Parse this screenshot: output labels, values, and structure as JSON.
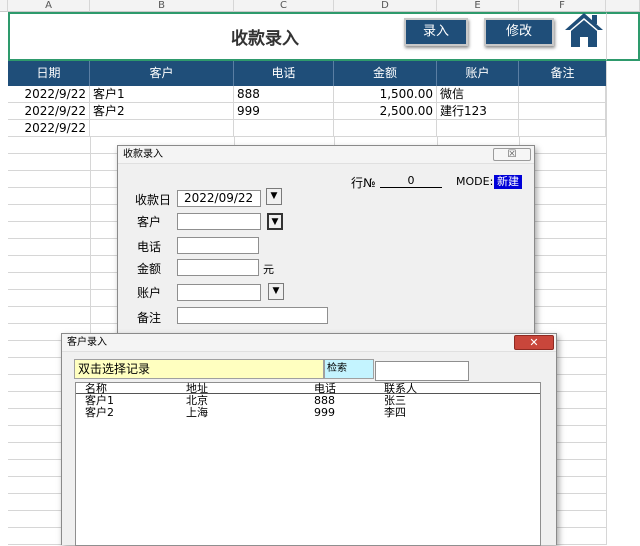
{
  "columns": [
    "A",
    "B",
    "C",
    "D",
    "E",
    "F"
  ],
  "title": "收款录入",
  "buttons": {
    "entry": "录入",
    "edit": "修改"
  },
  "headers": [
    "日期",
    "客户",
    "电话",
    "金额",
    "账户",
    "备注"
  ],
  "rows": [
    {
      "date": "2022/9/22",
      "customer": "客户1",
      "phone": "888",
      "amount": "1,500.00",
      "account": "微信"
    },
    {
      "date": "2022/9/22",
      "customer": "客户2",
      "phone": "999",
      "amount": "2,500.00",
      "account": "建行123"
    },
    {
      "date": "2022/9/22",
      "customer": "",
      "phone": "",
      "amount": "",
      "account": ""
    }
  ],
  "dialog1": {
    "title": "收款录入",
    "close": "☒",
    "row_label": "行№",
    "row_value": "0",
    "mode_label": "MODE:",
    "mode_value": "新建",
    "date_label": "收款日",
    "date_value": "2022/09/22",
    "customer_label": "客户",
    "customer_value": "",
    "phone_label": "电话",
    "phone_value": "",
    "amount_label": "金额",
    "amount_value": "",
    "amount_unit": "元",
    "account_label": "账户",
    "account_value": "",
    "remark_label": "备注",
    "remark_value": ""
  },
  "dialog2": {
    "title": "客户录入",
    "close": "✕",
    "hint": "双击选择记录",
    "search_label": "检索",
    "search_value": "",
    "list_headers": [
      "名称",
      "地址",
      "电话",
      "联系人"
    ],
    "list_rows": [
      [
        "客户1",
        "北京",
        "888",
        "张三"
      ],
      [
        "客户2",
        "上海",
        "999",
        "李四"
      ]
    ]
  },
  "colors": {
    "header_bg": "#1f4e79",
    "title_border": "#2e9a6c",
    "mode_bg": "#0000d8",
    "hint_bg": "#ffffc0",
    "search_bg": "#c4f4ff"
  }
}
